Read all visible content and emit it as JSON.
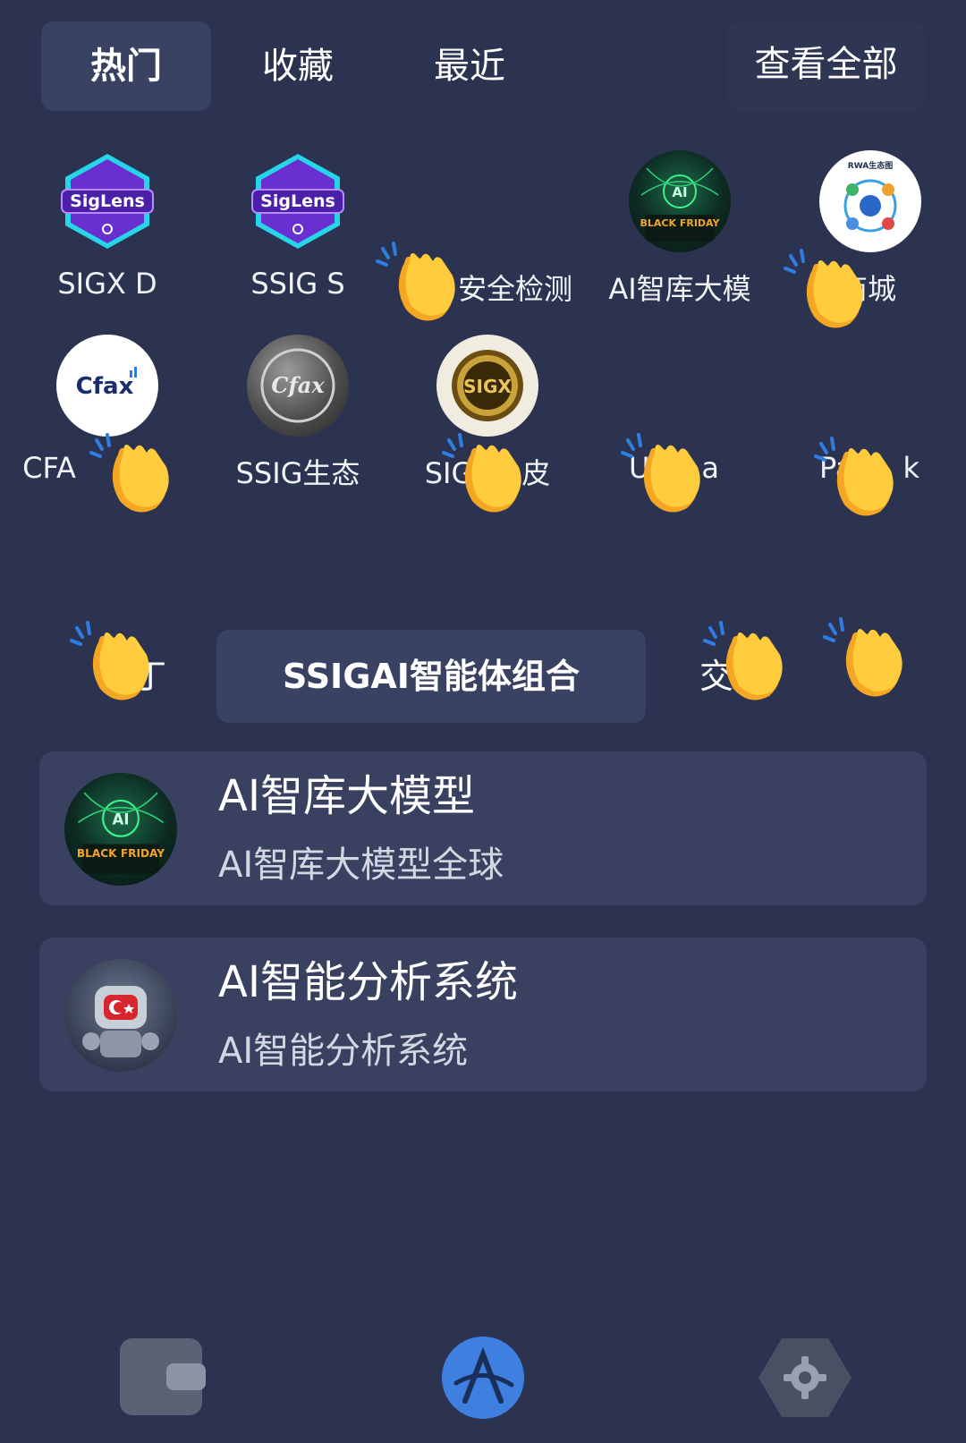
{
  "tabs": {
    "items": [
      {
        "label": "热门",
        "active": true
      },
      {
        "label": "收藏",
        "active": false
      },
      {
        "label": "最近",
        "active": false
      }
    ],
    "view_all": "查看全部"
  },
  "apps": [
    {
      "label": "SIGX D",
      "icon": "siglens-icon"
    },
    {
      "label": "SSIG S",
      "icon": "siglens-icon"
    },
    {
      "label": "安全检测",
      "icon": "none"
    },
    {
      "label": "AI智库大模",
      "icon": "ai-black-friday-icon",
      "badge_text": "AI",
      "badge_sub": "BLACK FRIDAY"
    },
    {
      "label": "商城",
      "icon": "rwa-ecosystem-icon",
      "badge_text": "RWA生态图"
    },
    {
      "label": "CFA",
      "icon": "cfax-icon",
      "badge_text": "Cfax"
    },
    {
      "label": "SSIG生态",
      "icon": "cfax-coin-icon",
      "badge_text": "Cfax"
    },
    {
      "label": "SIG",
      "label_suffix": "皮",
      "icon": "sigx-coin-icon",
      "badge_text": "SIGX"
    },
    {
      "label": "U",
      "label_suffix": "a",
      "icon": "none"
    },
    {
      "label": "Pa",
      "label_suffix": "k",
      "icon": "none"
    }
  ],
  "siglens_text": "SigLens",
  "categories": {
    "left": "丁",
    "active": "SSIGAI智能体组合",
    "right": "交"
  },
  "list": [
    {
      "title": "AI智库大模型",
      "subtitle": "AI智库大模型全球",
      "icon": "ai-black-friday-icon"
    },
    {
      "title": "AI智能分析系统",
      "subtitle": "AI智能分析系统",
      "icon": "robot-icon"
    }
  ],
  "bottom_nav": [
    {
      "name": "wallet",
      "icon": "wallet-icon"
    },
    {
      "name": "discover",
      "icon": "discover-icon"
    },
    {
      "name": "settings",
      "icon": "gear-icon"
    }
  ],
  "colors": {
    "background": "#2c3350",
    "card": "#3a4160",
    "tab_active": "#394262",
    "accent_blue": "#3f7fe0"
  }
}
